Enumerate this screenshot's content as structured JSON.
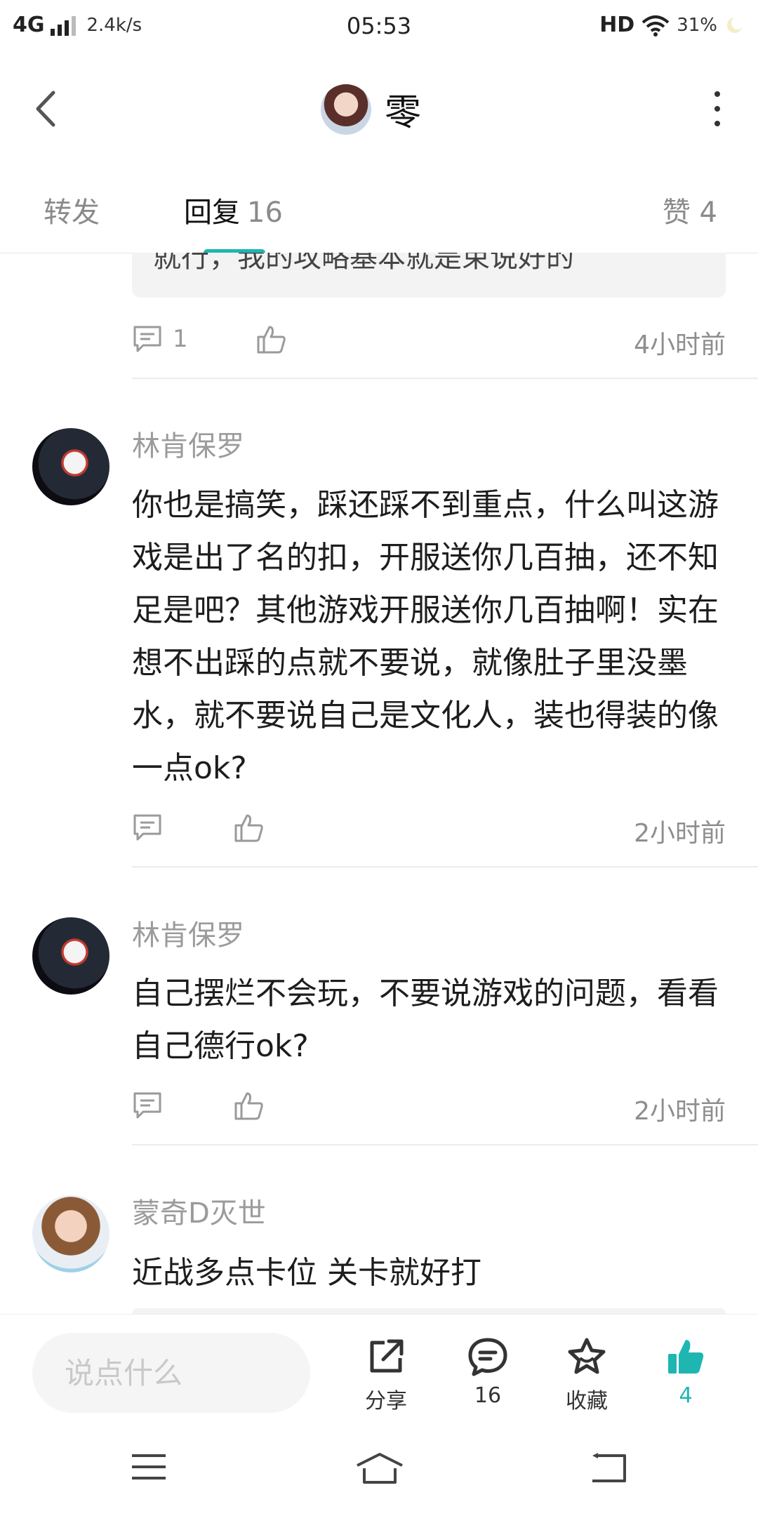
{
  "status_bar": {
    "network": "4G",
    "speed": "2.4k/s",
    "time": "05:53",
    "hd": "HD",
    "battery": "31%"
  },
  "header": {
    "title": "零",
    "avatar_icon": "user-avatar",
    "back_icon": "chevron-left-icon",
    "more_icon": "more-vertical-icon"
  },
  "tabs": {
    "forward": "转发",
    "reply": "回复",
    "reply_count": "16",
    "like": "赞 4",
    "active_color": "#1fb6b2"
  },
  "partial_quote": "就行，我的攻略基本就是束说好的",
  "partial_actions": {
    "comment_count": "1",
    "time": "4小时前"
  },
  "comments": [
    {
      "username": "林肯保罗",
      "text": "你也是搞笑，踩还踩不到重点，什么叫这游戏是出了名的扣，开服送你几百抽，还不知足是吧？其他游戏开服送你几百抽啊！实在想不出踩的点就不要说，就像肚子里没墨水，就不要说自己是文化人，装也得装的像一点ok?",
      "time": "2小时前"
    },
    {
      "username": "林肯保罗",
      "text": "自己摆烂不会玩，不要说游戏的问题，看看自己德行ok?",
      "time": "2小时前"
    },
    {
      "username": "蒙奇D灭世",
      "text": "近战多点卡位 关卡就好打"
    }
  ],
  "bottom_bar": {
    "input_placeholder": "说点什么",
    "share_label": "分享",
    "comment_count": "16",
    "favorite_label": "收藏",
    "like_count": "4"
  }
}
